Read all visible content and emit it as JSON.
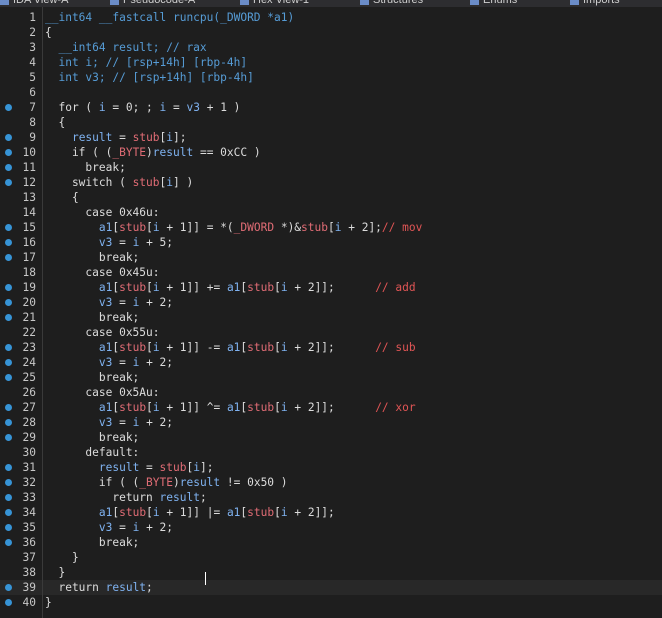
{
  "tabs": [
    {
      "label": "IDA View-A"
    },
    {
      "label": "Pseudocode-A"
    },
    {
      "label": "Hex View-1"
    },
    {
      "label": "Structures"
    },
    {
      "label": "Enums"
    },
    {
      "label": "Imports"
    }
  ],
  "lines": [
    {
      "n": "1",
      "bp": false,
      "segs": [
        [
          "typ",
          "__int64 __fastcall runcpu(_DWORD *a1)"
        ]
      ]
    },
    {
      "n": "2",
      "bp": false,
      "segs": [
        [
          "op",
          "{"
        ]
      ]
    },
    {
      "n": "3",
      "bp": false,
      "segs": [
        [
          "typ",
          "  __int64 result; // rax"
        ]
      ]
    },
    {
      "n": "4",
      "bp": false,
      "segs": [
        [
          "typ",
          "  int i; // [rsp+14h] [rbp-4h]"
        ]
      ]
    },
    {
      "n": "5",
      "bp": false,
      "segs": [
        [
          "typ",
          "  int v3; // [rsp+14h] [rbp-4h]"
        ]
      ]
    },
    {
      "n": "6",
      "bp": false,
      "segs": []
    },
    {
      "n": "7",
      "bp": true,
      "segs": [
        [
          "op",
          "  for ( "
        ],
        [
          "lvar",
          "i"
        ],
        [
          "op",
          " = 0; ; "
        ],
        [
          "lvar",
          "i"
        ],
        [
          "op",
          " = "
        ],
        [
          "lvar",
          "v3"
        ],
        [
          "op",
          " + 1 )"
        ]
      ]
    },
    {
      "n": "8",
      "bp": false,
      "segs": [
        [
          "op",
          "  {"
        ]
      ]
    },
    {
      "n": "9",
      "bp": true,
      "segs": [
        [
          "op",
          "    "
        ],
        [
          "lvar",
          "result"
        ],
        [
          "op",
          " = "
        ],
        [
          "gvar",
          "stub"
        ],
        [
          "op",
          "["
        ],
        [
          "lvar",
          "i"
        ],
        [
          "op",
          "];"
        ]
      ]
    },
    {
      "n": "10",
      "bp": true,
      "segs": [
        [
          "op",
          "    if ( ("
        ],
        [
          "gvar",
          "_BYTE"
        ],
        [
          "op",
          ")"
        ],
        [
          "lvar",
          "result"
        ],
        [
          "op",
          " == 0xCC )"
        ]
      ]
    },
    {
      "n": "11",
      "bp": true,
      "segs": [
        [
          "op",
          "      break;"
        ]
      ]
    },
    {
      "n": "12",
      "bp": true,
      "segs": [
        [
          "op",
          "    switch ( "
        ],
        [
          "gvar",
          "stub"
        ],
        [
          "op",
          "["
        ],
        [
          "lvar",
          "i"
        ],
        [
          "op",
          "] )"
        ]
      ]
    },
    {
      "n": "13",
      "bp": false,
      "segs": [
        [
          "op",
          "    {"
        ]
      ]
    },
    {
      "n": "14",
      "bp": false,
      "segs": [
        [
          "op",
          "      case 0x46u:"
        ]
      ]
    },
    {
      "n": "15",
      "bp": true,
      "segs": [
        [
          "op",
          "        "
        ],
        [
          "lvar",
          "a1"
        ],
        [
          "op",
          "["
        ],
        [
          "gvar",
          "stub"
        ],
        [
          "op",
          "["
        ],
        [
          "lvar",
          "i"
        ],
        [
          "op",
          " + 1]] = *("
        ],
        [
          "gvar",
          "_DWORD"
        ],
        [
          "op",
          " *)&"
        ],
        [
          "gvar",
          "stub"
        ],
        [
          "op",
          "["
        ],
        [
          "lvar",
          "i"
        ],
        [
          "op",
          " + 2];"
        ],
        [
          "cmt2",
          "// mov"
        ]
      ]
    },
    {
      "n": "16",
      "bp": true,
      "segs": [
        [
          "op",
          "        "
        ],
        [
          "lvar",
          "v3"
        ],
        [
          "op",
          " = "
        ],
        [
          "lvar",
          "i"
        ],
        [
          "op",
          " + 5;"
        ]
      ]
    },
    {
      "n": "17",
      "bp": true,
      "segs": [
        [
          "op",
          "        break;"
        ]
      ]
    },
    {
      "n": "18",
      "bp": false,
      "segs": [
        [
          "op",
          "      case 0x45u:"
        ]
      ]
    },
    {
      "n": "19",
      "bp": true,
      "segs": [
        [
          "op",
          "        "
        ],
        [
          "lvar",
          "a1"
        ],
        [
          "op",
          "["
        ],
        [
          "gvar",
          "stub"
        ],
        [
          "op",
          "["
        ],
        [
          "lvar",
          "i"
        ],
        [
          "op",
          " + 1]] += "
        ],
        [
          "lvar",
          "a1"
        ],
        [
          "op",
          "["
        ],
        [
          "gvar",
          "stub"
        ],
        [
          "op",
          "["
        ],
        [
          "lvar",
          "i"
        ],
        [
          "op",
          " + 2]];      "
        ],
        [
          "cmt2",
          "// add"
        ]
      ]
    },
    {
      "n": "20",
      "bp": true,
      "segs": [
        [
          "op",
          "        "
        ],
        [
          "lvar",
          "v3"
        ],
        [
          "op",
          " = "
        ],
        [
          "lvar",
          "i"
        ],
        [
          "op",
          " + 2;"
        ]
      ]
    },
    {
      "n": "21",
      "bp": true,
      "segs": [
        [
          "op",
          "        break;"
        ]
      ]
    },
    {
      "n": "22",
      "bp": false,
      "segs": [
        [
          "op",
          "      case 0x55u:"
        ]
      ]
    },
    {
      "n": "23",
      "bp": true,
      "segs": [
        [
          "op",
          "        "
        ],
        [
          "lvar",
          "a1"
        ],
        [
          "op",
          "["
        ],
        [
          "gvar",
          "stub"
        ],
        [
          "op",
          "["
        ],
        [
          "lvar",
          "i"
        ],
        [
          "op",
          " + 1]] -= "
        ],
        [
          "lvar",
          "a1"
        ],
        [
          "op",
          "["
        ],
        [
          "gvar",
          "stub"
        ],
        [
          "op",
          "["
        ],
        [
          "lvar",
          "i"
        ],
        [
          "op",
          " + 2]];      "
        ],
        [
          "cmt2",
          "// sub"
        ]
      ]
    },
    {
      "n": "24",
      "bp": true,
      "segs": [
        [
          "op",
          "        "
        ],
        [
          "lvar",
          "v3"
        ],
        [
          "op",
          " = "
        ],
        [
          "lvar",
          "i"
        ],
        [
          "op",
          " + 2;"
        ]
      ]
    },
    {
      "n": "25",
      "bp": true,
      "segs": [
        [
          "op",
          "        break;"
        ]
      ]
    },
    {
      "n": "26",
      "bp": false,
      "segs": [
        [
          "op",
          "      case 0x5Au:"
        ]
      ]
    },
    {
      "n": "27",
      "bp": true,
      "segs": [
        [
          "op",
          "        "
        ],
        [
          "lvar",
          "a1"
        ],
        [
          "op",
          "["
        ],
        [
          "gvar",
          "stub"
        ],
        [
          "op",
          "["
        ],
        [
          "lvar",
          "i"
        ],
        [
          "op",
          " + 1]] ^= "
        ],
        [
          "lvar",
          "a1"
        ],
        [
          "op",
          "["
        ],
        [
          "gvar",
          "stub"
        ],
        [
          "op",
          "["
        ],
        [
          "lvar",
          "i"
        ],
        [
          "op",
          " + 2]];      "
        ],
        [
          "cmt2",
          "// xor"
        ]
      ]
    },
    {
      "n": "28",
      "bp": true,
      "segs": [
        [
          "op",
          "        "
        ],
        [
          "lvar",
          "v3"
        ],
        [
          "op",
          " = "
        ],
        [
          "lvar",
          "i"
        ],
        [
          "op",
          " + 2;"
        ]
      ]
    },
    {
      "n": "29",
      "bp": true,
      "segs": [
        [
          "op",
          "        break;"
        ]
      ]
    },
    {
      "n": "30",
      "bp": false,
      "segs": [
        [
          "op",
          "      default:"
        ]
      ]
    },
    {
      "n": "31",
      "bp": true,
      "segs": [
        [
          "op",
          "        "
        ],
        [
          "lvar",
          "result"
        ],
        [
          "op",
          " = "
        ],
        [
          "gvar",
          "stub"
        ],
        [
          "op",
          "["
        ],
        [
          "lvar",
          "i"
        ],
        [
          "op",
          "];"
        ]
      ]
    },
    {
      "n": "32",
      "bp": true,
      "segs": [
        [
          "op",
          "        if ( ("
        ],
        [
          "gvar",
          "_BYTE"
        ],
        [
          "op",
          ")"
        ],
        [
          "lvar",
          "result"
        ],
        [
          "op",
          " != 0x50 )"
        ]
      ]
    },
    {
      "n": "33",
      "bp": true,
      "segs": [
        [
          "op",
          "          return "
        ],
        [
          "lvar",
          "result"
        ],
        [
          "op",
          ";"
        ]
      ]
    },
    {
      "n": "34",
      "bp": true,
      "segs": [
        [
          "op",
          "        "
        ],
        [
          "lvar",
          "a1"
        ],
        [
          "op",
          "["
        ],
        [
          "gvar",
          "stub"
        ],
        [
          "op",
          "["
        ],
        [
          "lvar",
          "i"
        ],
        [
          "op",
          " + 1]] |= "
        ],
        [
          "lvar",
          "a1"
        ],
        [
          "op",
          "["
        ],
        [
          "gvar",
          "stub"
        ],
        [
          "op",
          "["
        ],
        [
          "lvar",
          "i"
        ],
        [
          "op",
          " + 2]];"
        ]
      ]
    },
    {
      "n": "35",
      "bp": true,
      "segs": [
        [
          "op",
          "        "
        ],
        [
          "lvar",
          "v3"
        ],
        [
          "op",
          " = "
        ],
        [
          "lvar",
          "i"
        ],
        [
          "op",
          " + 2;"
        ]
      ]
    },
    {
      "n": "36",
      "bp": true,
      "segs": [
        [
          "op",
          "        break;"
        ]
      ]
    },
    {
      "n": "37",
      "bp": false,
      "segs": [
        [
          "op",
          "    }"
        ]
      ]
    },
    {
      "n": "38",
      "bp": false,
      "segs": [
        [
          "op",
          "  }"
        ]
      ]
    },
    {
      "n": "39",
      "bp": true,
      "segs": [
        [
          "op",
          "  return "
        ],
        [
          "lvar",
          "result"
        ],
        [
          "op",
          ";"
        ]
      ]
    },
    {
      "n": "40",
      "bp": true,
      "segs": [
        [
          "op",
          "}"
        ]
      ]
    }
  ],
  "current_line": "39",
  "colors": {
    "background": "#1e1e1e",
    "breakpoint": "#3794d6",
    "type_text": "#569cd6",
    "global_symbol": "#e06c75",
    "local_var": "#7fb2f0",
    "comment": "#e05555"
  },
  "icons": {
    "breakpoint": "breakpoint-dot-icon",
    "tab": "tab-icon"
  }
}
